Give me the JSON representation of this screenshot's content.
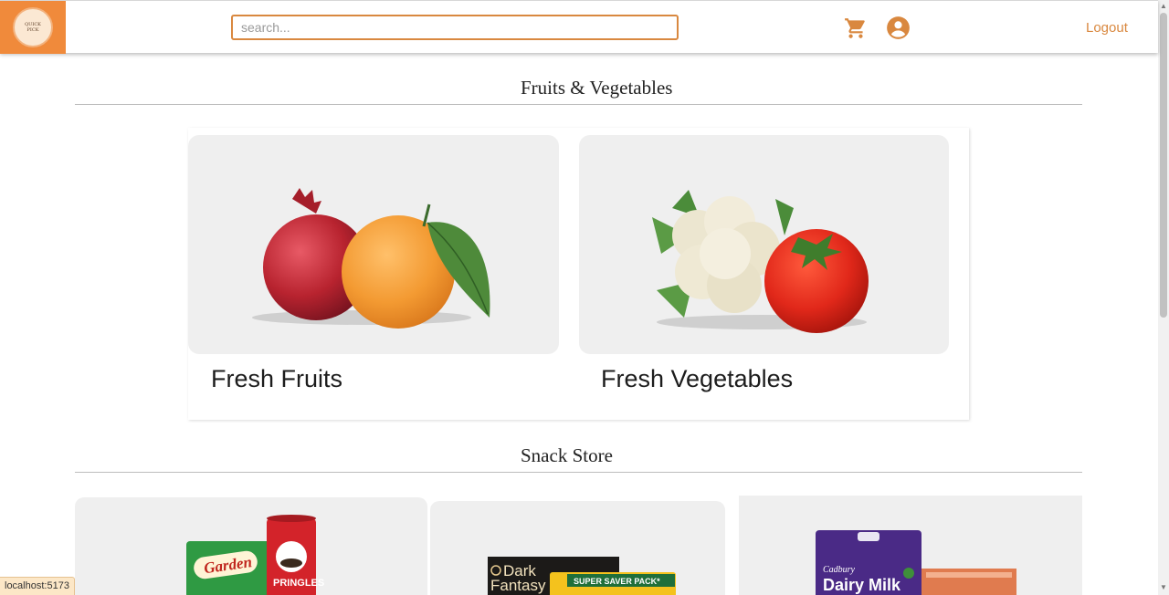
{
  "header": {
    "logo_text": [
      "QUICK",
      "PICK"
    ],
    "search_placeholder": "search...",
    "logout_label": "Logout",
    "cart_icon": "shopping-cart-icon",
    "user_icon": "account-circle-icon"
  },
  "sections": {
    "fruits_vegetables": {
      "title": "Fruits & Vegetables",
      "items": [
        {
          "label": "Fresh Fruits"
        },
        {
          "label": "Fresh Vegetables"
        }
      ]
    },
    "snacks": {
      "title": "Snack Store",
      "items": [
        {
          "brands": [
            "Garden",
            "PRINGLES"
          ]
        },
        {
          "brands": [
            "Dark",
            "Fantasy",
            "SUPER SAVER PACK*"
          ]
        },
        {
          "brands": [
            "Cadbury",
            "Dairy Milk"
          ]
        }
      ]
    }
  },
  "status_bar": {
    "url": "localhost:5173"
  },
  "colors": {
    "accent": "#d9883f",
    "logo_bg": "#f08a3b",
    "tile_bg": "#efefef"
  }
}
